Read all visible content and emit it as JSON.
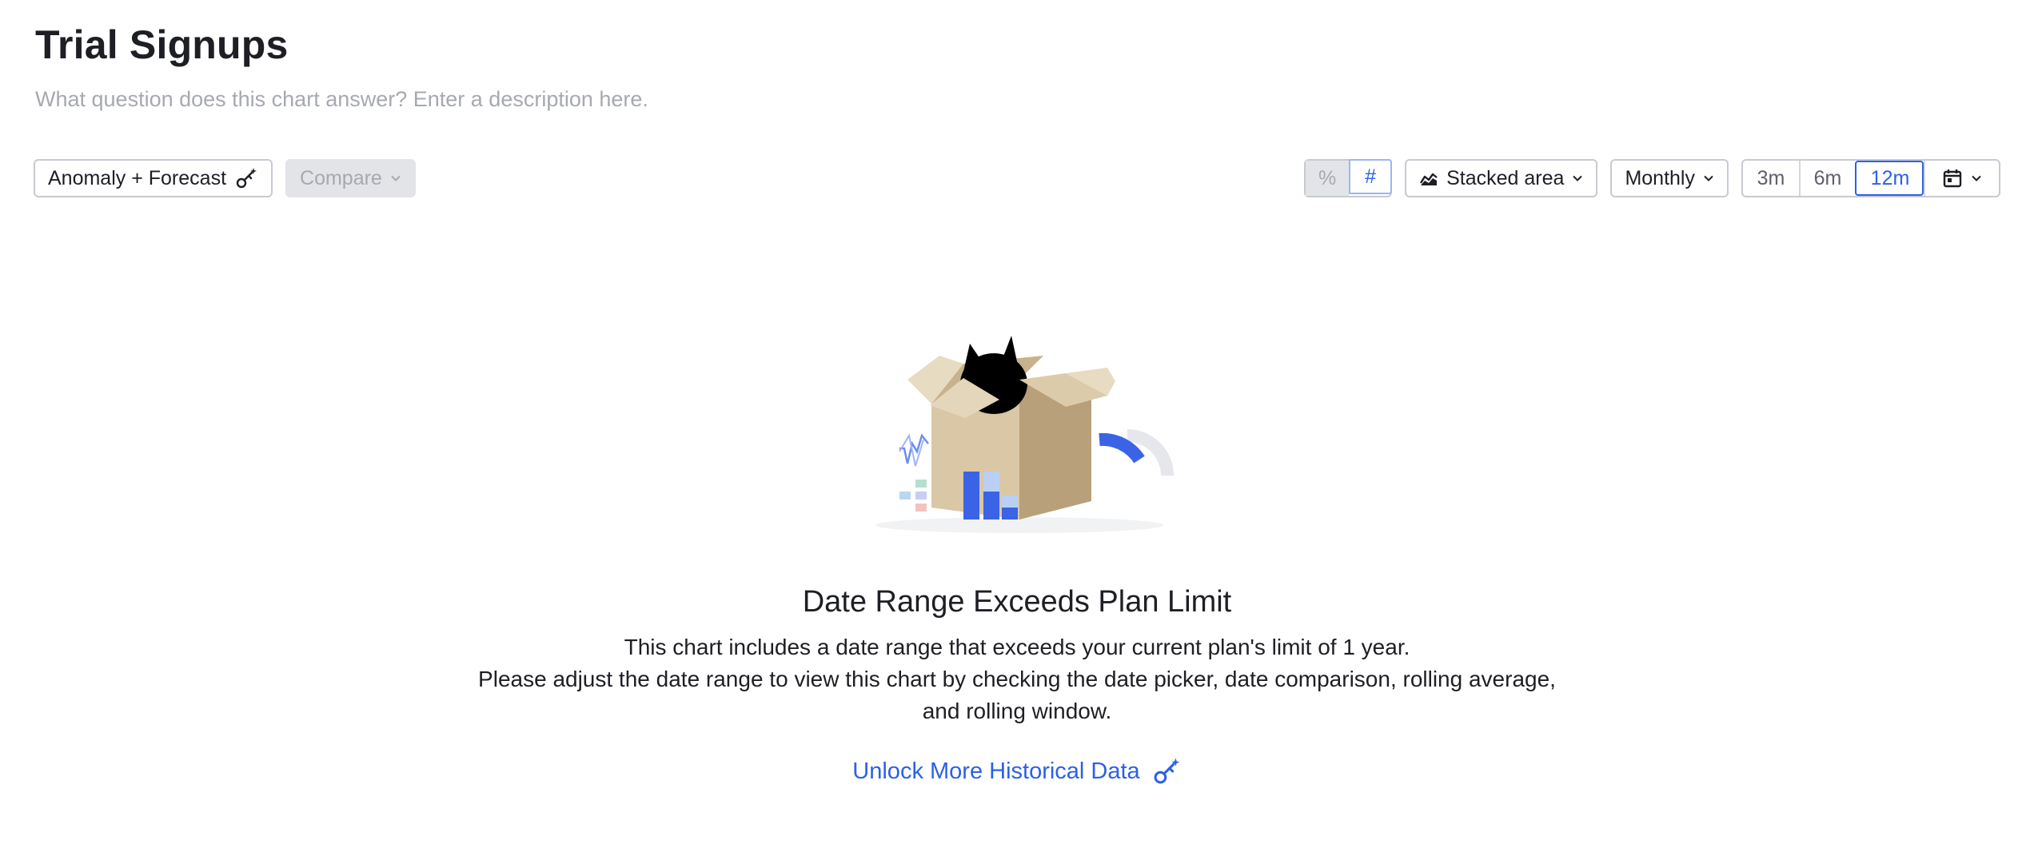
{
  "header": {
    "title": "Trial Signups",
    "description_placeholder": "What question does this chart answer? Enter a description here."
  },
  "toolbar": {
    "anomaly_label": "Anomaly + Forecast",
    "compare_label": "Compare",
    "percent_label": "%",
    "count_label": "#",
    "chart_type_label": "Stacked area",
    "interval_label": "Monthly",
    "range_options": [
      "3m",
      "6m",
      "12m"
    ],
    "range_selected": "12m"
  },
  "empty_state": {
    "headline": "Date Range Exceeds Plan Limit",
    "line1": "This chart includes a date range that exceeds your current plan's limit of 1 year.",
    "line2": "Please adjust the date range to view this chart by checking the date picker, date comparison, rolling average,",
    "line3": "and rolling window.",
    "unlock_label": "Unlock More Historical Data"
  },
  "colors": {
    "accent": "#2b61e8",
    "text": "#1e1f24",
    "muted": "#a7a9b0"
  },
  "icons": [
    "key-sparkle-icon",
    "chevron-down-icon",
    "stacked-area-icon",
    "calendar-icon"
  ]
}
